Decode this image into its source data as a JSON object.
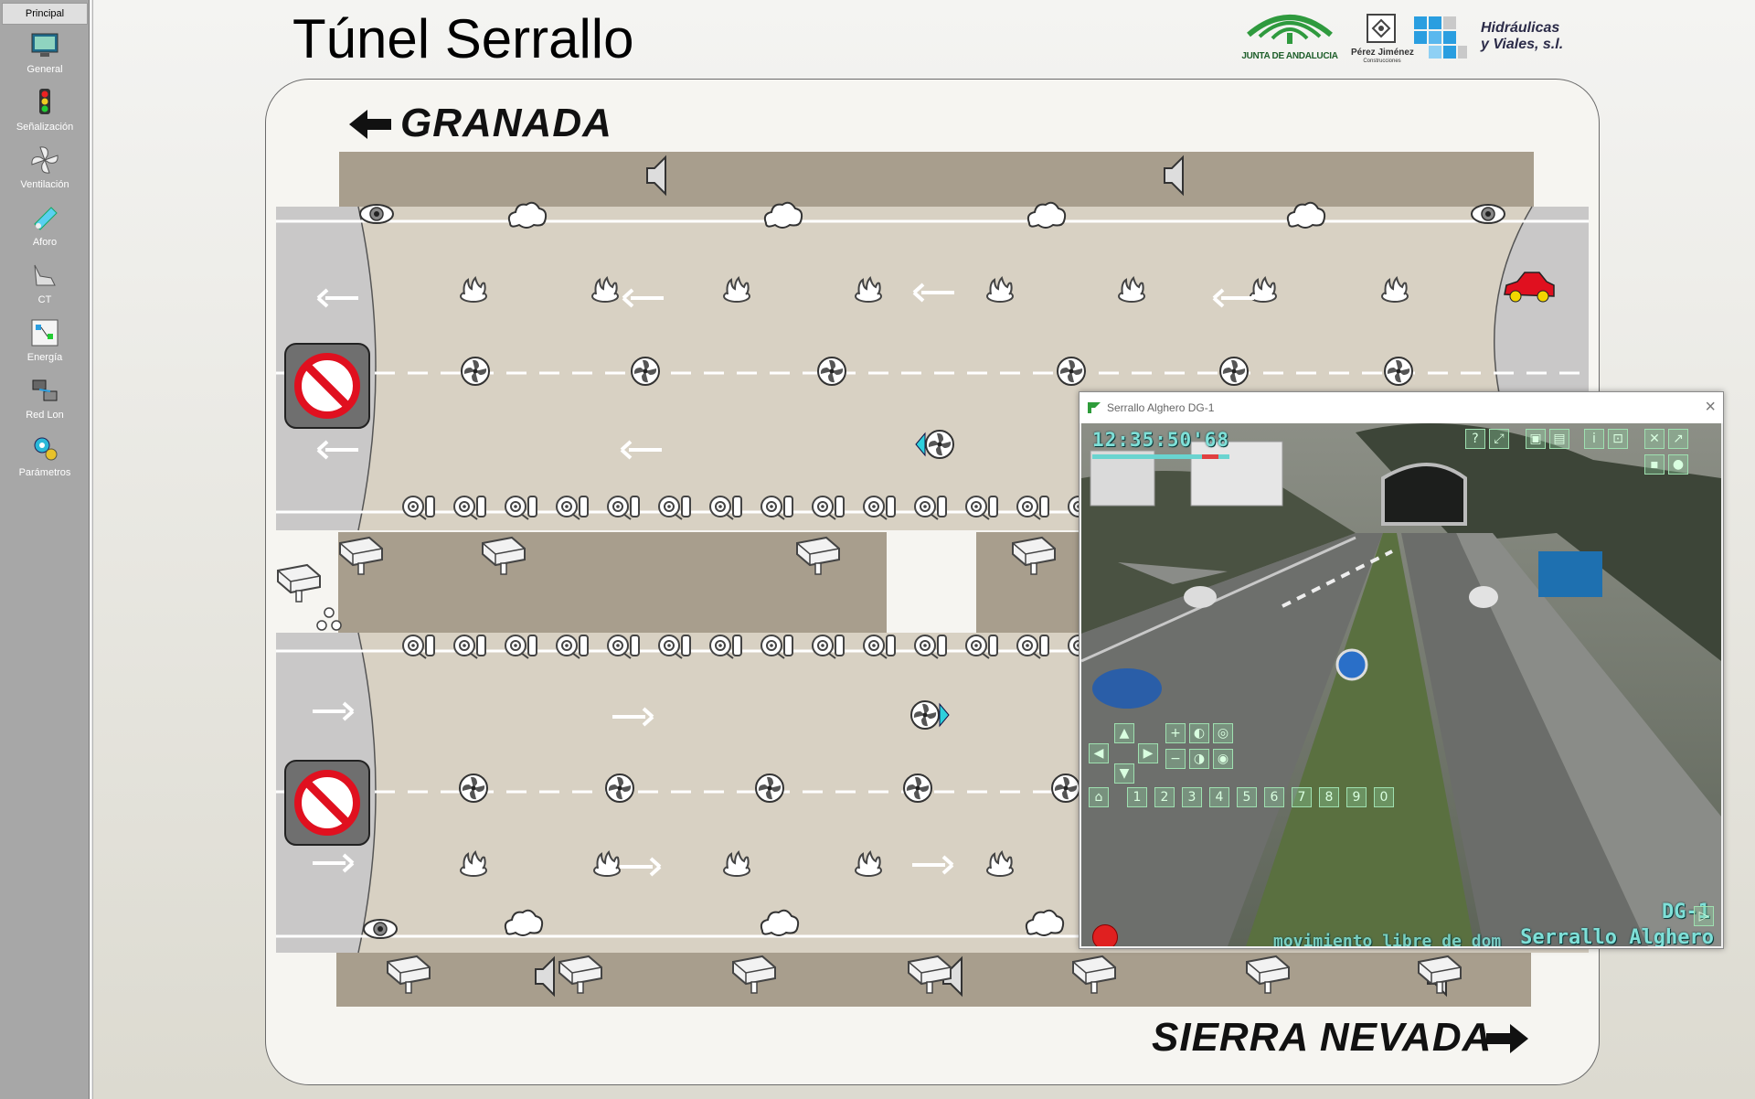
{
  "sidebar": {
    "tab_label": "Principal",
    "items": [
      {
        "label": "General",
        "icon": "monitor-icon"
      },
      {
        "label": "Señalización",
        "icon": "traffic-light-icon"
      },
      {
        "label": "Ventilación",
        "icon": "fan-icon"
      },
      {
        "label": "Aforo",
        "icon": "counter-icon"
      },
      {
        "label": "CT",
        "icon": "transformer-icon"
      },
      {
        "label": "Energía",
        "icon": "energy-icon"
      },
      {
        "label": "Red Lon",
        "icon": "network-icon"
      },
      {
        "label": "Parámetros",
        "icon": "settings-icon"
      }
    ]
  },
  "header": {
    "title": "Túnel Serrallo",
    "logos": {
      "junta": "JUNTA DE ANDALUCIA",
      "perez_jimenez": "Pérez Jiménez",
      "perez_jimenez_sub": "Construcciones",
      "hidraulicas_line1": "Hidráulicas",
      "hidraulicas_line2": "y Viales, s.l."
    }
  },
  "tunnel": {
    "direction_top": "GRANADA",
    "direction_bottom": "SIERRA NEVADA",
    "colors": {
      "road": "#d8d1c3",
      "walkway": "#a89e8d",
      "portal": "#c9c8c8",
      "stop_sign_red": "#e0101f"
    }
  },
  "camera_window": {
    "title": "Serrallo Alghero DG-1",
    "timestamp": "12:35:50'68",
    "camera_id": "DG-1",
    "camera_name": "Serrallo Alghero",
    "scroll_text": "movimiento libre de dom",
    "presets": [
      "1",
      "2",
      "3",
      "4",
      "5",
      "6",
      "7",
      "8",
      "9",
      "0"
    ]
  }
}
